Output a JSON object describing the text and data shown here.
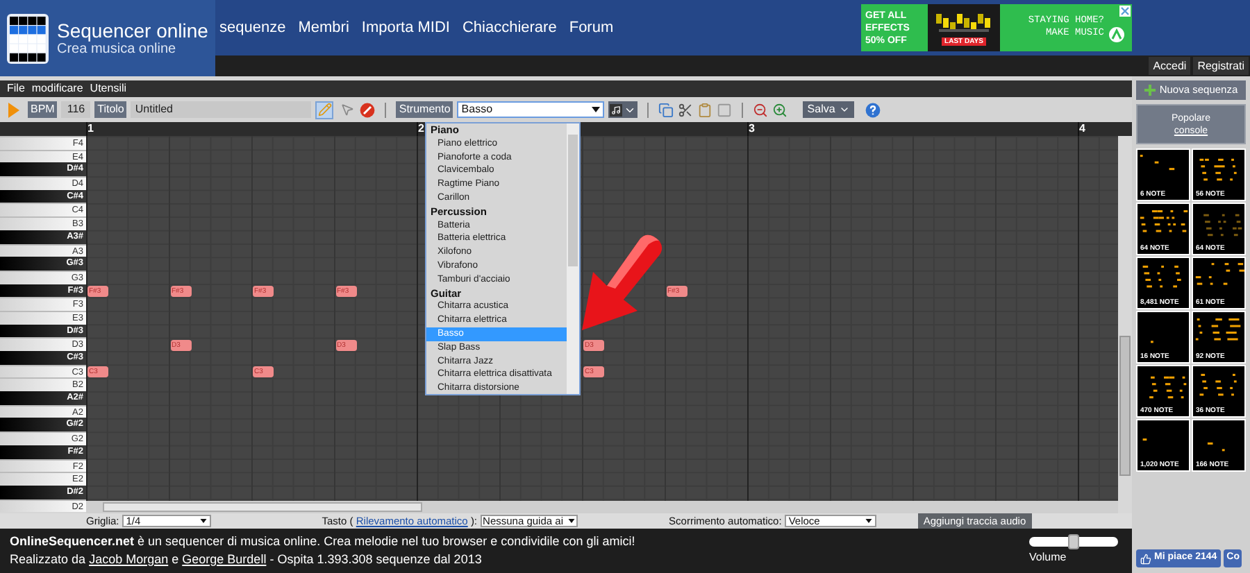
{
  "header": {
    "logo_title": "Sequencer online",
    "logo_subtitle": "Crea musica online",
    "nav": [
      "sequenze",
      "Membri",
      "Importa MIDI",
      "Chiacchierare",
      "Forum"
    ],
    "ad": {
      "headline": [
        "GET ALL",
        "EFFECTS",
        "50% OFF"
      ],
      "badge": "LAST DAYS",
      "slogan": [
        "STAYING HOME?",
        "MAKE MUSIC"
      ]
    },
    "account": [
      "Accedi",
      "Registrati"
    ]
  },
  "menu": [
    "File",
    "modificare",
    "Utensili"
  ],
  "toolbar": {
    "bpm_label": "BPM",
    "bpm": "116",
    "title_label": "Titolo",
    "title": "Untitled",
    "tools": [
      {
        "kind": "pencil",
        "selected": true
      },
      {
        "kind": "pointer",
        "selected": false
      }
    ],
    "instrument_label": "Strumento",
    "instrument": "Basso",
    "instrument_open": true,
    "save": "Salva"
  },
  "instrument_list": [
    {
      "group": "Piano",
      "items": [
        {
          "label": "Piano elettrico",
          "selected": false
        },
        {
          "label": "Pianoforte a coda",
          "selected": false
        },
        {
          "label": "Clavicembalo",
          "selected": false
        },
        {
          "label": "Ragtime Piano",
          "selected": false
        },
        {
          "label": "Carillon",
          "selected": false
        }
      ]
    },
    {
      "group": "Percussion",
      "items": [
        {
          "label": "Batteria",
          "selected": false
        },
        {
          "label": "Batteria elettrica",
          "selected": false
        },
        {
          "label": "Xilofono",
          "selected": false
        },
        {
          "label": "Vibrafono",
          "selected": false
        },
        {
          "label": "Tamburi d'acciaio",
          "selected": false
        }
      ]
    },
    {
      "group": "Guitar",
      "items": [
        {
          "label": "Chitarra acustica",
          "selected": false
        },
        {
          "label": "Chitarra elettrica",
          "selected": false
        },
        {
          "label": "Basso",
          "selected": true
        },
        {
          "label": "Slap Bass",
          "selected": false
        },
        {
          "label": "Chitarra Jazz",
          "selected": false
        },
        {
          "label": "Chitarra elettrica disattivata",
          "selected": false
        },
        {
          "label": "Chitarra distorsione",
          "selected": false
        }
      ]
    }
  ],
  "ruler": [
    "1",
    "2",
    "3",
    "4"
  ],
  "keys": [
    {
      "label": "F4",
      "black": false
    },
    {
      "label": "E4",
      "black": false
    },
    {
      "label": "D#4",
      "black": true
    },
    {
      "label": "D4",
      "black": false
    },
    {
      "label": "C#4",
      "black": true
    },
    {
      "label": "C4",
      "black": false
    },
    {
      "label": "B3",
      "black": false
    },
    {
      "label": "A3#",
      "black": true
    },
    {
      "label": "A3",
      "black": false
    },
    {
      "label": "G#3",
      "black": true
    },
    {
      "label": "G3",
      "black": false
    },
    {
      "label": "F#3",
      "black": true,
      "steps": [
        {
          "on": true,
          "label": "F#3"
        },
        {
          "on": true,
          "label": "F#3"
        },
        {
          "on": true,
          "label": "F#3"
        },
        {
          "on": true,
          "label": "F#3"
        },
        {
          "on": false
        },
        {
          "on": false
        },
        {
          "on": false
        },
        {
          "on": true,
          "label": "F#3"
        }
      ]
    },
    {
      "label": "F3",
      "black": false
    },
    {
      "label": "E3",
      "black": false
    },
    {
      "label": "D#3",
      "black": true
    },
    {
      "label": "D3",
      "black": false,
      "steps": [
        {
          "on": false
        },
        {
          "on": true,
          "label": "D3"
        },
        {
          "on": false
        },
        {
          "on": true,
          "label": "D3"
        },
        {
          "on": false
        },
        {
          "on": false
        },
        {
          "on": true,
          "label": "D3"
        }
      ]
    },
    {
      "label": "C#3",
      "black": true
    },
    {
      "label": "C3",
      "black": false,
      "steps": [
        {
          "on": true,
          "label": "C3"
        },
        {
          "on": false
        },
        {
          "on": true,
          "label": "C3"
        },
        {
          "on": false
        },
        {
          "on": false
        },
        {
          "on": false
        },
        {
          "on": true,
          "label": "C3"
        }
      ]
    },
    {
      "label": "B2",
      "black": false
    },
    {
      "label": "A2#",
      "black": true
    },
    {
      "label": "A2",
      "black": false
    },
    {
      "label": "G#2",
      "black": true
    },
    {
      "label": "G2",
      "black": false
    },
    {
      "label": "F#2",
      "black": true
    },
    {
      "label": "F2",
      "black": false
    },
    {
      "label": "E2",
      "black": false
    },
    {
      "label": "D#2",
      "black": true
    },
    {
      "label": "D2",
      "black": false
    }
  ],
  "controls": {
    "grid_label": "Griglia:",
    "grid": "1/4",
    "key_label": "Tasto (",
    "key_link": "Rilevamento automatico",
    "key_close": "):",
    "guide": "Nessuna guida ai",
    "scroll_label": "Scorrimento automatico:",
    "scroll": "Veloce",
    "add_audio": "Aggiungi traccia audio"
  },
  "footer": {
    "about": "**OnlineSequencer.net** è un sequencer di musica online. Crea melodie nel tuo browser e condividile con gli amici!",
    "credits_prefix": "Realizzato da",
    "authors": [
      "Jacob Morgan",
      "George Burdell"
    ],
    "credits_joiner": "e",
    "credits_suffix": "- Ospita 1.393.308 sequenze dal 2013",
    "volume": {
      "label": "Volume",
      "level": 0.5
    }
  },
  "sidebar": {
    "new_sequence": "Nuova sequenza",
    "popular_title": "Popolare",
    "popular_link": "console",
    "previews": [
      {
        "caption": "6 NOTE"
      },
      {
        "caption": "56 NOTE"
      },
      {
        "caption": "64 NOTE"
      },
      {
        "caption": "64 NOTE"
      },
      {
        "caption": "8,481 NOTE"
      },
      {
        "caption": "61 NOTE"
      },
      {
        "caption": "16 NOTE"
      },
      {
        "caption": "92 NOTE"
      },
      {
        "caption": "470 NOTE"
      },
      {
        "caption": "36 NOTE"
      },
      {
        "caption": "1,020 NOTE"
      },
      {
        "caption": "166 NOTE"
      }
    ],
    "like": "Mi piace 2144",
    "share": "Co"
  }
}
